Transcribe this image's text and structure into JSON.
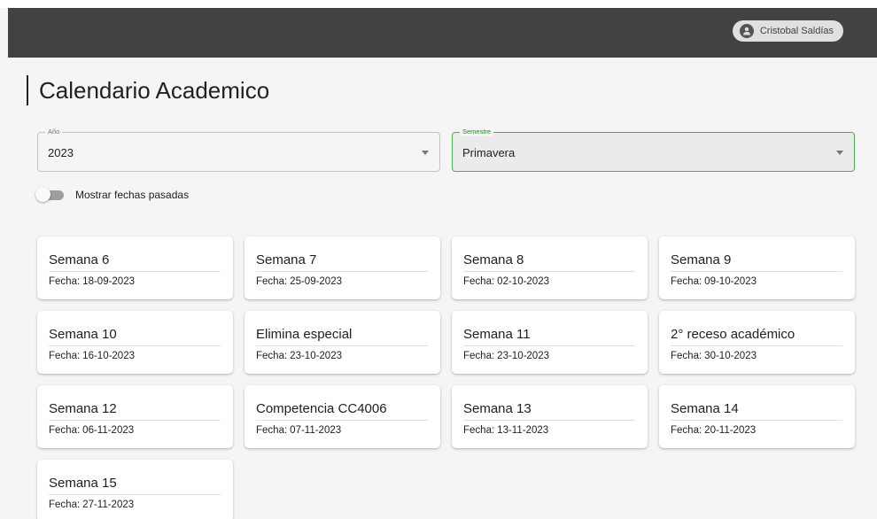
{
  "header": {
    "user_name": "Cristobal Saldías"
  },
  "page": {
    "title": "Calendario Academico"
  },
  "filters": {
    "year": {
      "label": "Año",
      "value": "2023"
    },
    "semester": {
      "label": "Semestre",
      "value": "Primavera"
    },
    "show_past_toggle": {
      "label": "Mostrar fechas pasadas",
      "checked": false
    }
  },
  "events": [
    {
      "title": "Semana 6",
      "date_label": "Fecha:",
      "date": "18-09-2023"
    },
    {
      "title": "Semana 7",
      "date_label": "Fecha:",
      "date": "25-09-2023"
    },
    {
      "title": "Semana 8",
      "date_label": "Fecha:",
      "date": "02-10-2023"
    },
    {
      "title": "Semana 9",
      "date_label": "Fecha:",
      "date": "09-10-2023"
    },
    {
      "title": "Semana 10",
      "date_label": "Fecha:",
      "date": "16-10-2023"
    },
    {
      "title": "Elimina especial",
      "date_label": "Fecha:",
      "date": "23-10-2023"
    },
    {
      "title": "Semana 11",
      "date_label": "Fecha:",
      "date": "23-10-2023"
    },
    {
      "title": "2° receso académico",
      "date_label": "Fecha:",
      "date": "30-10-2023"
    },
    {
      "title": "Semana 12",
      "date_label": "Fecha:",
      "date": "06-11-2023"
    },
    {
      "title": "Competencia CC4006",
      "date_label": "Fecha:",
      "date": "07-11-2023"
    },
    {
      "title": "Semana 13",
      "date_label": "Fecha:",
      "date": "13-11-2023"
    },
    {
      "title": "Semana 14",
      "date_label": "Fecha:",
      "date": "20-11-2023"
    },
    {
      "title": "Semana 15",
      "date_label": "Fecha:",
      "date": "27-11-2023"
    }
  ],
  "icons": {
    "user": "person-icon",
    "select_caret": "caret-down-icon"
  },
  "colors": {
    "topbar": "#424242",
    "focus_accent": "#4caf50"
  }
}
